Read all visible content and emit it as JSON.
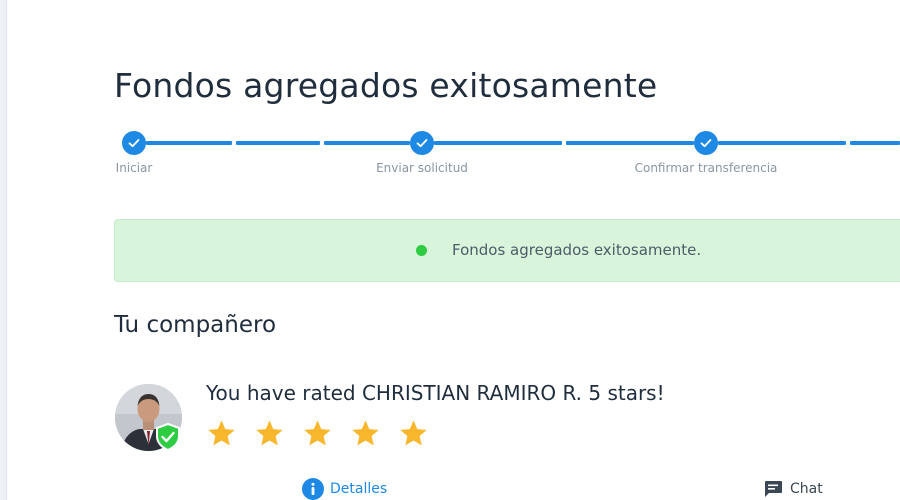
{
  "page": {
    "title": "Fondos agregados exitosamente"
  },
  "stepper": {
    "steps": [
      {
        "label": "Iniciar",
        "completed": true
      },
      {
        "label": "Enviar solicitud",
        "completed": true
      },
      {
        "label": "Confirmar transferencia",
        "completed": true
      }
    ],
    "icon": "check-icon",
    "color": "#1e88e5"
  },
  "banner": {
    "message": "Fondos agregados exitosamente.",
    "background": "#d8f5dc",
    "dot_color": "#2ecc40"
  },
  "partner": {
    "section_title": "Tu compañero",
    "rating_text": "You have rated CHRISTIAN RAMIRO R. 5 stars!",
    "rating": 5,
    "rating_max": 5,
    "verified": true,
    "star_color": "#f7b62c",
    "badge_color": "#2ecc40"
  },
  "actions": {
    "details_label": "Detalles",
    "details_icon": "info-icon",
    "chat_label": "Chat",
    "chat_icon": "chat-bubble-icon"
  }
}
